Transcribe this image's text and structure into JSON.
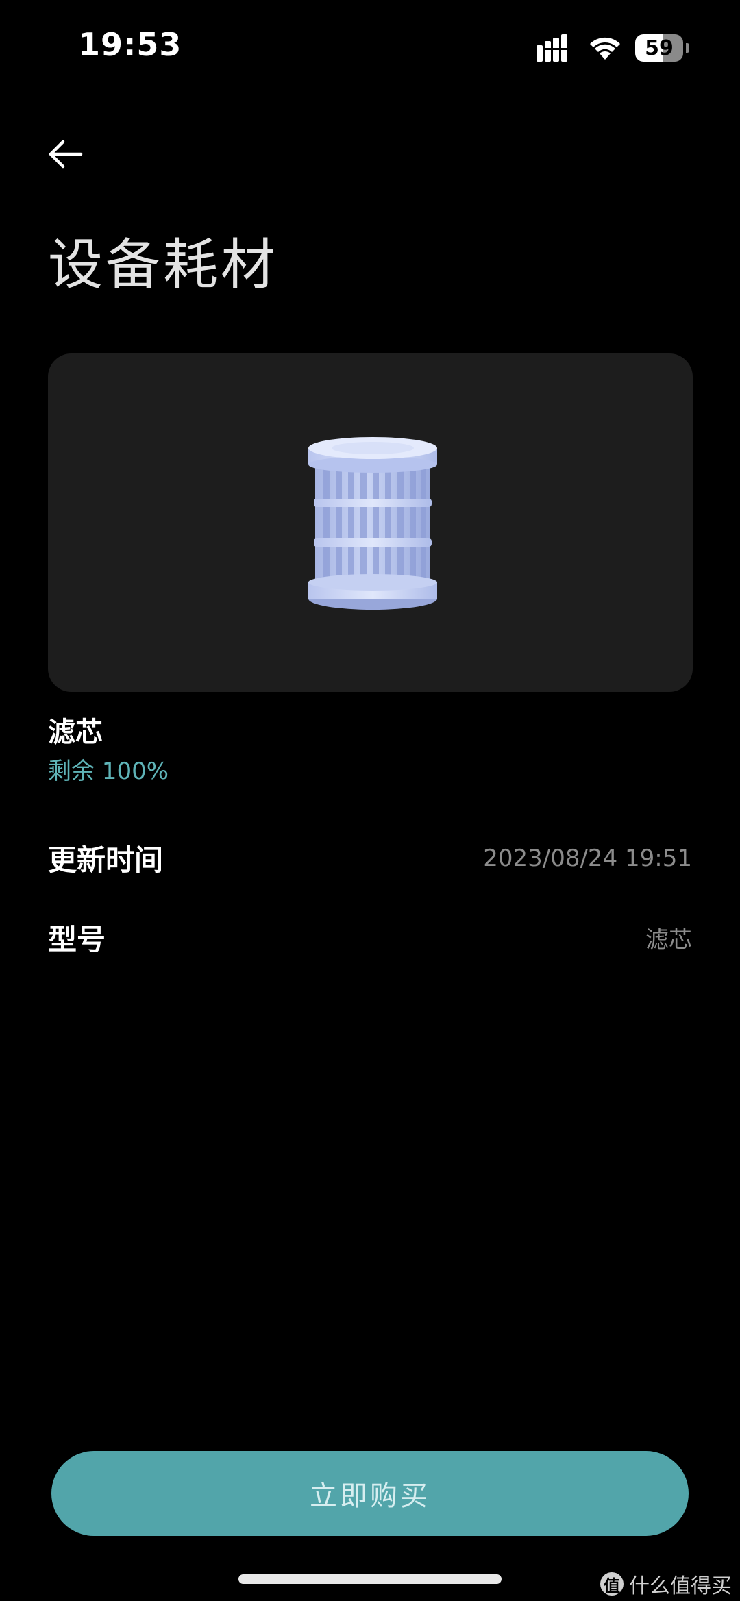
{
  "status_bar": {
    "time": "19:53",
    "battery_level": "59",
    "battery_fraction": 0.59,
    "icons": [
      "signal-icon",
      "wifi-icon",
      "battery-icon"
    ]
  },
  "header": {
    "back_icon": "back-arrow-icon",
    "title": "设备耗材"
  },
  "consumable": {
    "image": "filter-cartridge-image",
    "name": "滤芯",
    "remaining": "剩余 100%"
  },
  "details": {
    "update_time_label": "更新时间",
    "update_time_value": "2023/08/24 19:51",
    "model_label": "型号",
    "model_value": "滤芯"
  },
  "actions": {
    "buy_label": "立即购买"
  },
  "watermark": {
    "logo_text": "值",
    "text": "什么值得买"
  },
  "colors": {
    "background": "#000000",
    "card": "#1d1d1d",
    "accent": "#52a5aa",
    "remaining_text": "#5fb4b8",
    "secondary_text": "#8c8c8c"
  }
}
